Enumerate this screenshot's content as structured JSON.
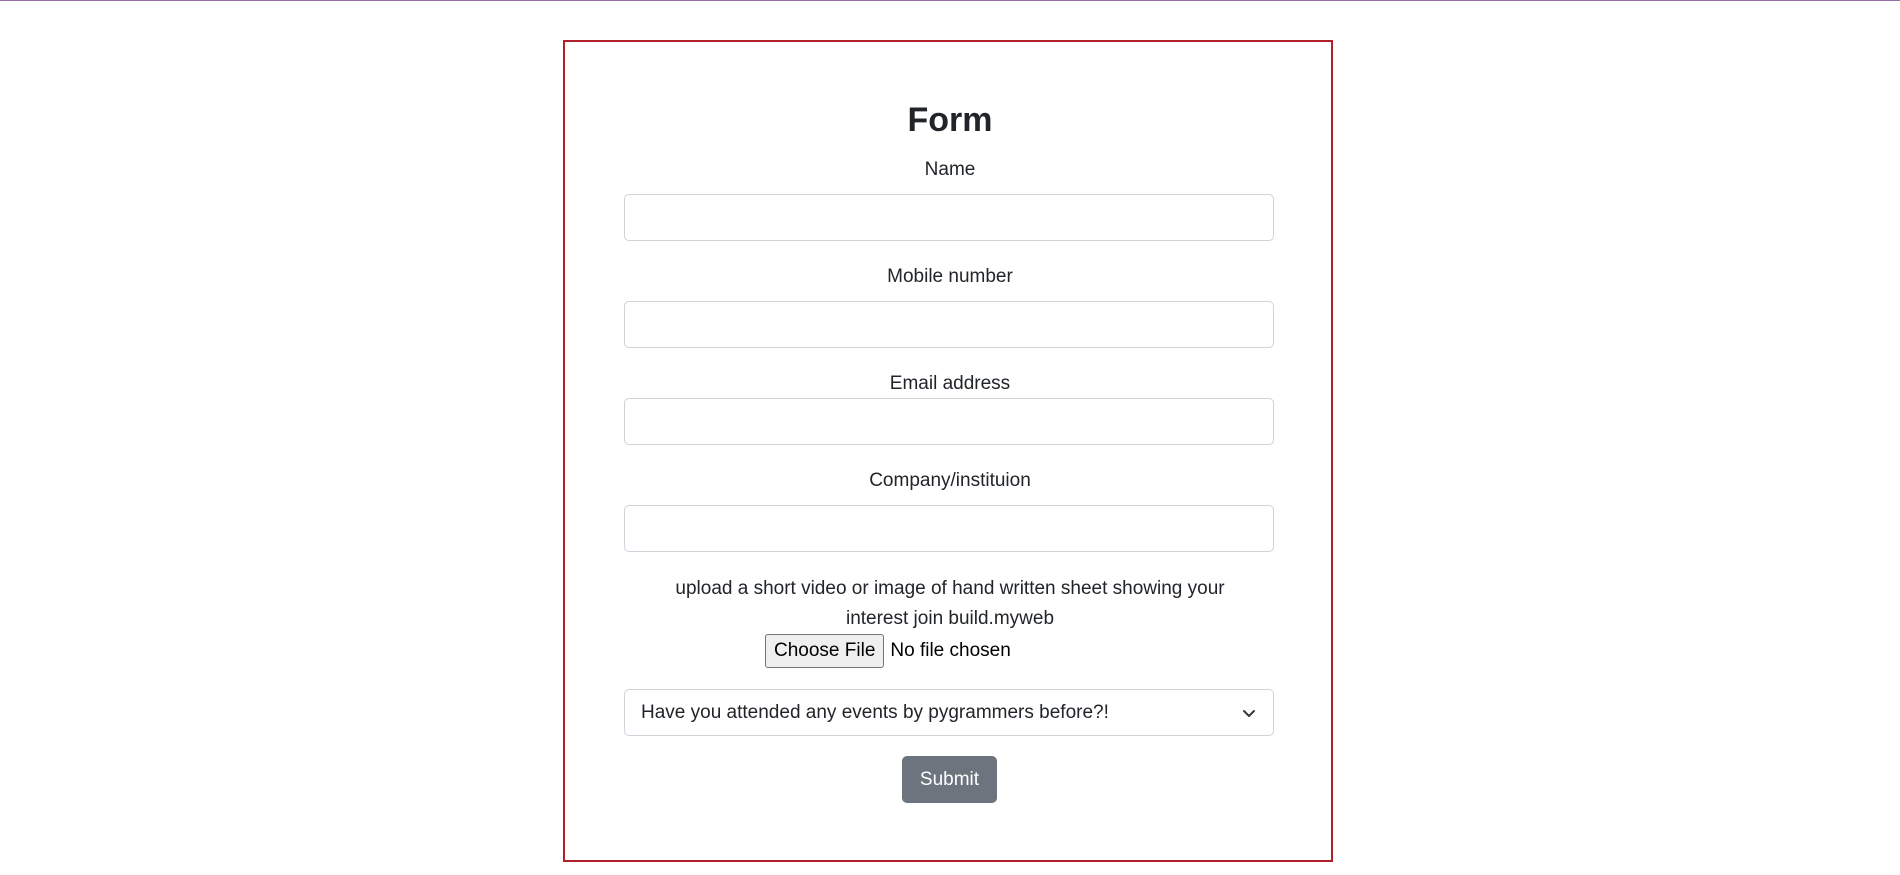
{
  "form": {
    "title": "Form",
    "fields": {
      "name": {
        "label": "Name",
        "value": "",
        "placeholder": ""
      },
      "mobile": {
        "label": "Mobile number",
        "value": "",
        "placeholder": ""
      },
      "email": {
        "label": "Email address",
        "value": "",
        "placeholder": ""
      },
      "company": {
        "label": "Company/instituion",
        "value": "",
        "placeholder": ""
      }
    },
    "upload": {
      "prompt_line1": "upload a short video or image of hand written sheet showing your",
      "prompt_line2": "interest join build.myweb",
      "button_label": "Choose File",
      "status": "No file chosen"
    },
    "events_select": {
      "selected": "Have you attended any events by pygrammers before?!",
      "icon": "chevron-down-icon"
    },
    "submit_label": "Submit"
  },
  "colors": {
    "card_border": "#b0202a",
    "submit_bg": "#6c757d",
    "input_border": "#ced4da",
    "top_line": "#9b6fa8"
  }
}
